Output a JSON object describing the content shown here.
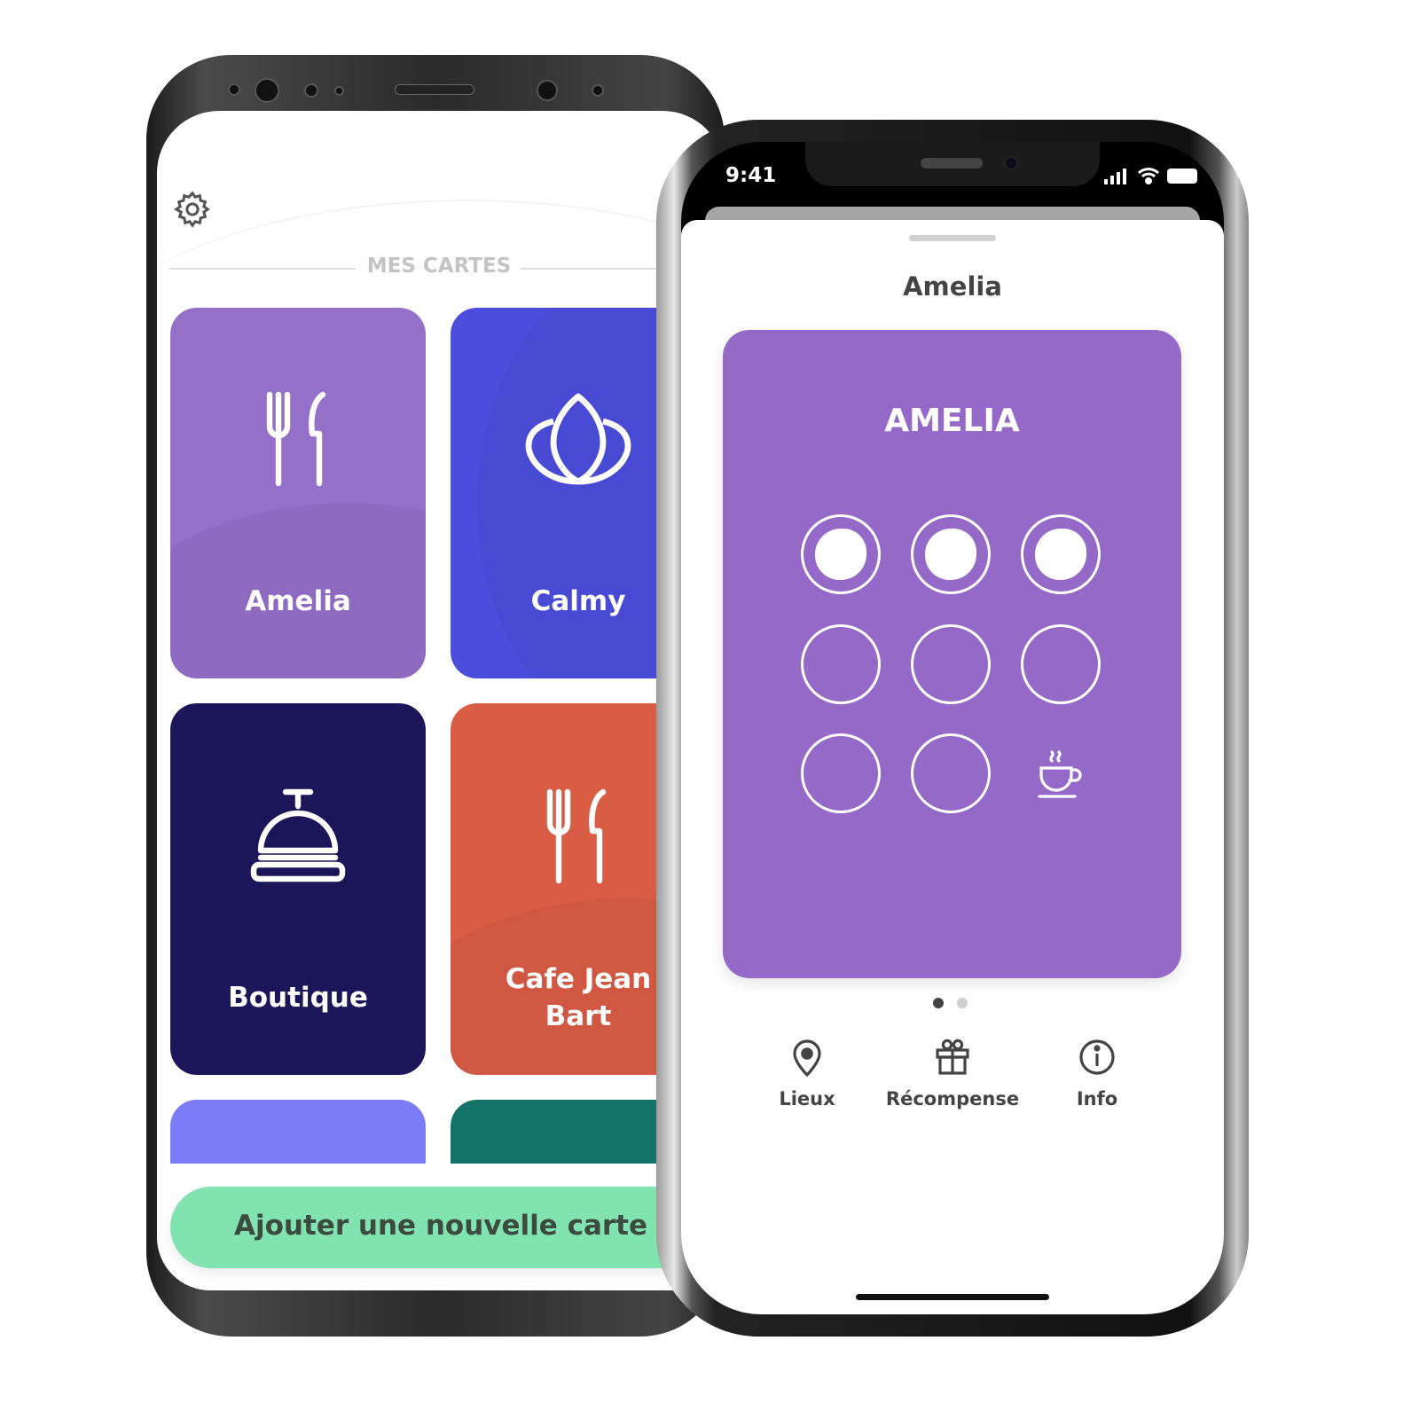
{
  "android": {
    "section_title": "MES CARTES",
    "cards": [
      {
        "label": "Amelia",
        "icon": "fork-knife-icon",
        "color": "#9470c8"
      },
      {
        "label": "Calmy",
        "icon": "lotus-icon",
        "color": "#4b4edc"
      },
      {
        "label": "Boutique",
        "icon": "service-bell-icon",
        "color": "#1a1659"
      },
      {
        "label": "Cafe Jean Bart",
        "icon": "fork-knife-icon",
        "color": "#d95c45"
      },
      {
        "label": "",
        "color": "#7b7cf8"
      },
      {
        "label": "",
        "color": "#147367"
      }
    ],
    "add_button": "Ajouter une nouvelle carte",
    "add_button_color": "#80e3b0"
  },
  "iphone": {
    "time": "9:41",
    "sheet_title": "Amelia",
    "card_title": "AMELIA",
    "card_color": "#9469c8",
    "stamps_filled": 3,
    "stamps_total": 8,
    "reward_icon": "coffee-cup-icon",
    "page_indicator": {
      "current": 1,
      "total": 2
    },
    "nav": [
      {
        "label": "Lieux",
        "icon": "map-pin-icon"
      },
      {
        "label": "Récompense",
        "icon": "gift-icon"
      },
      {
        "label": "Info",
        "icon": "info-icon"
      }
    ]
  }
}
